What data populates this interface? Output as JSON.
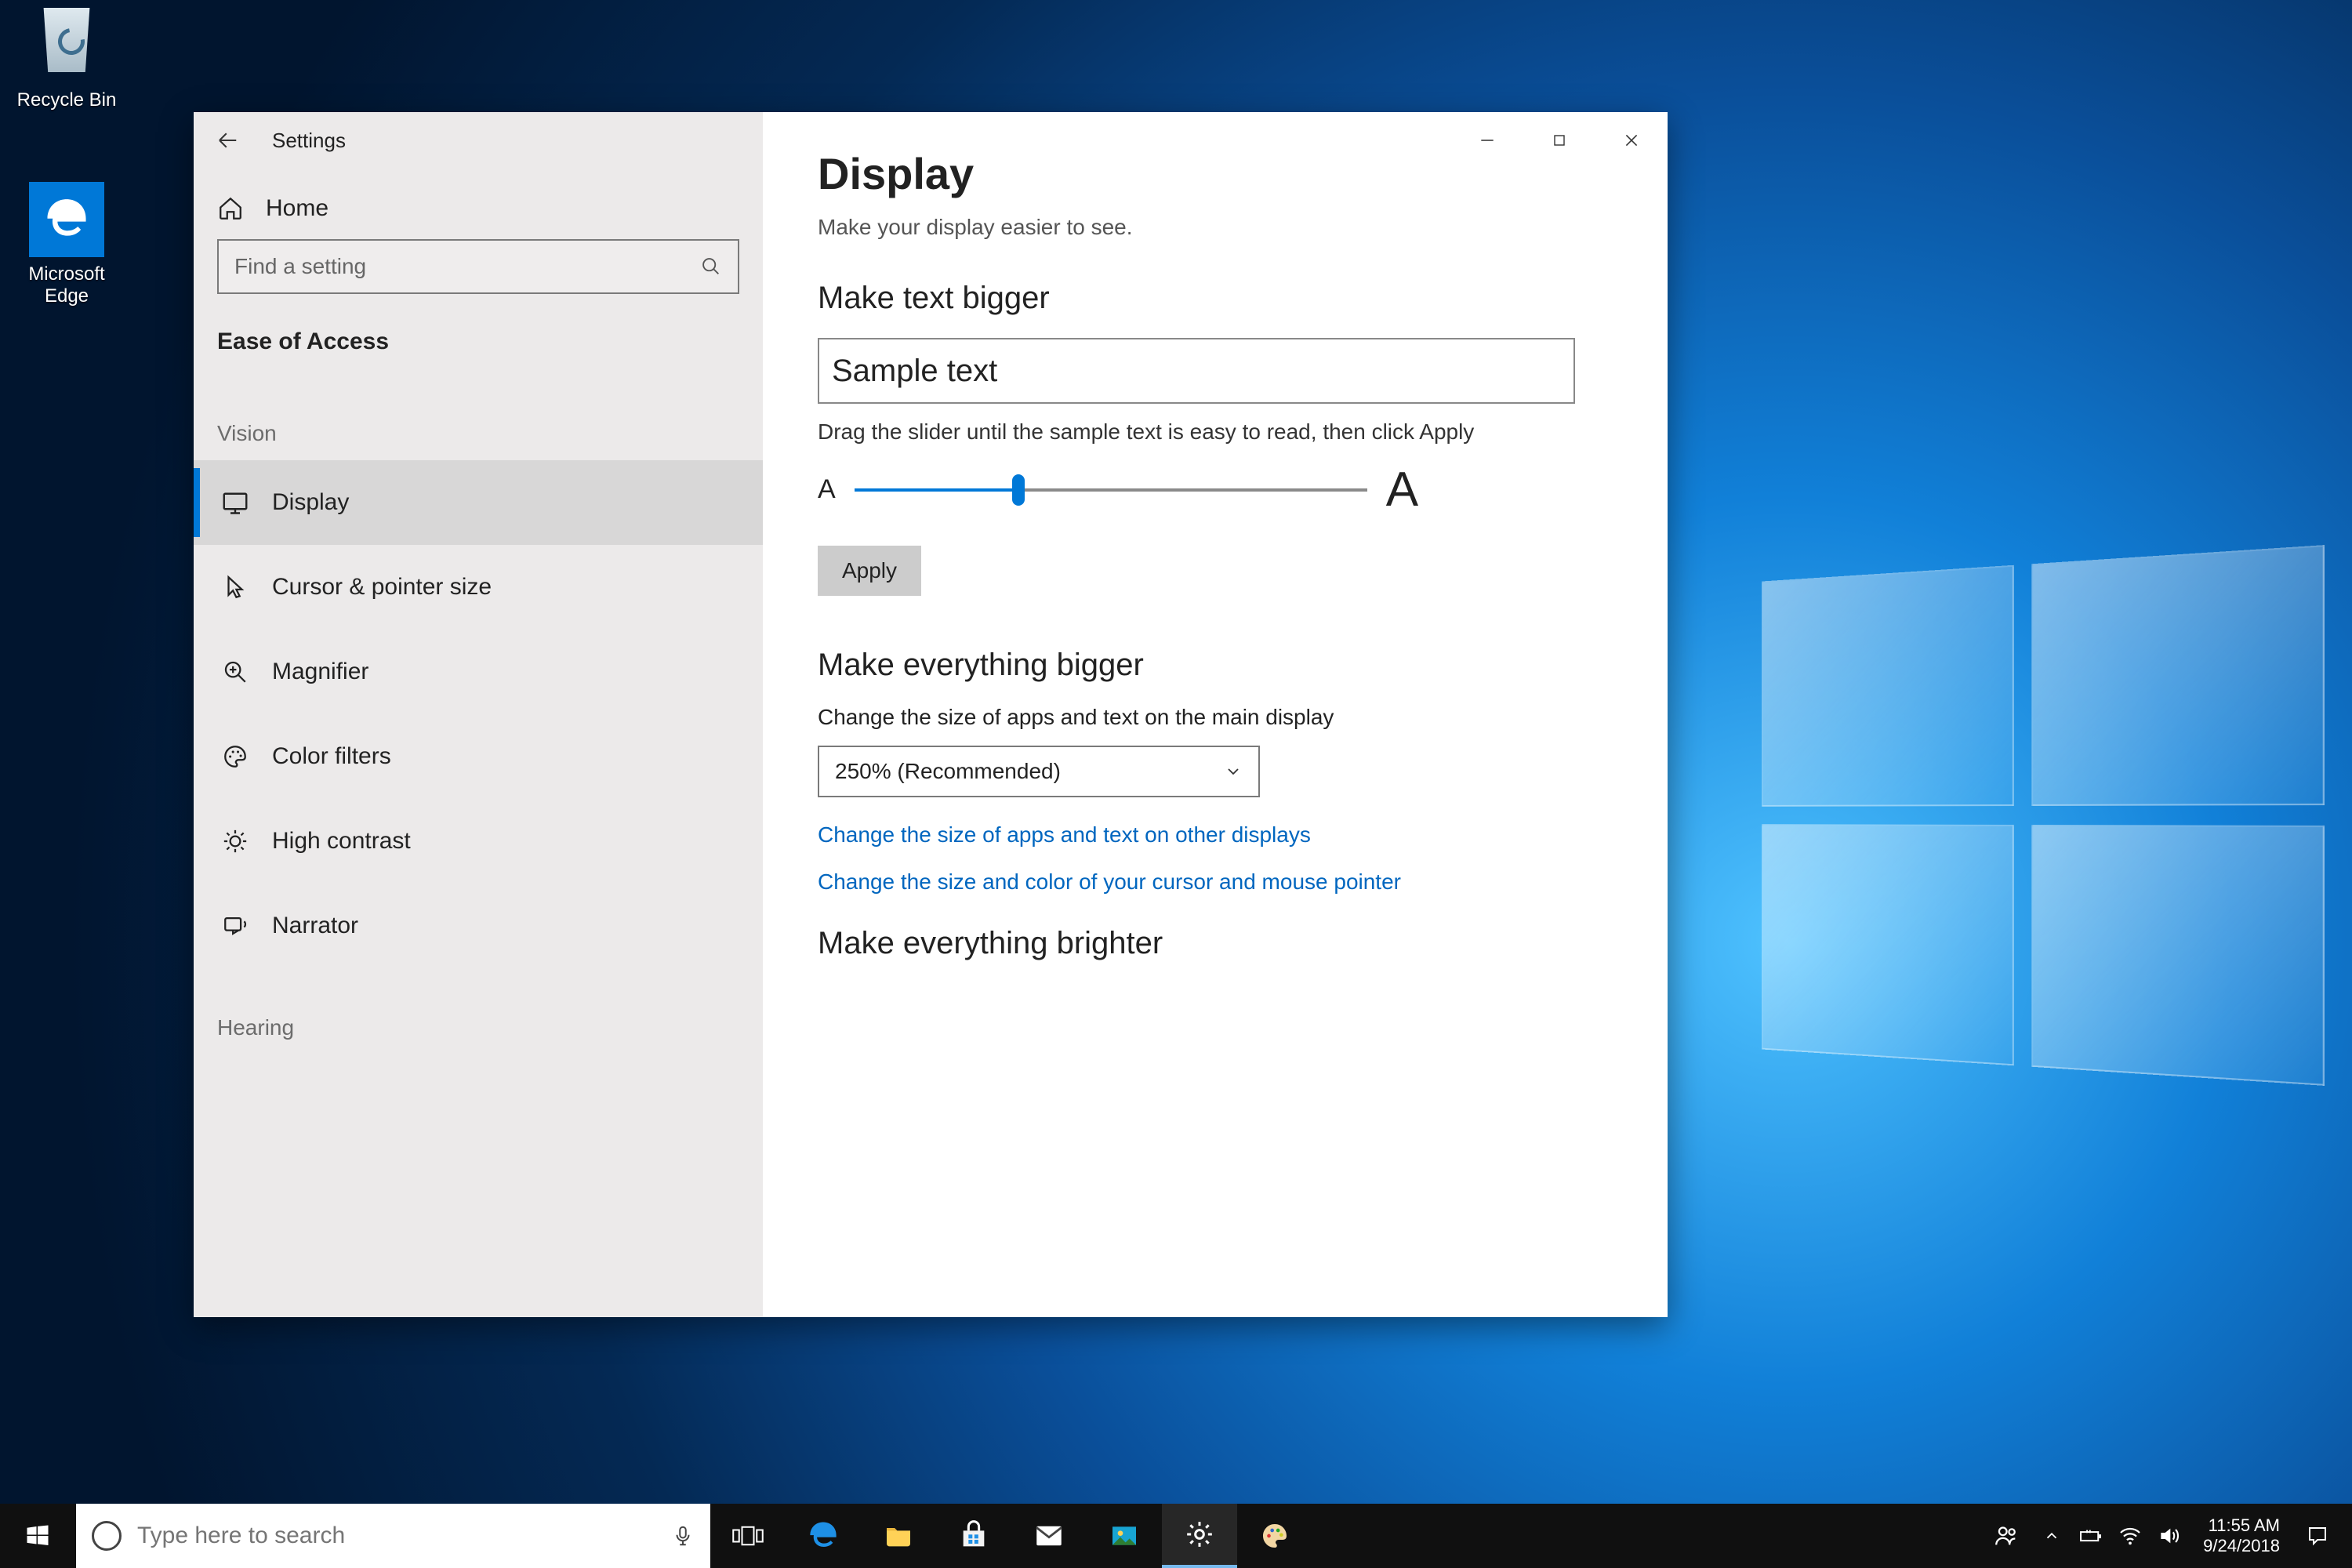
{
  "desktop": {
    "recycle_label": "Recycle Bin",
    "edge_label": "Microsoft Edge"
  },
  "window": {
    "title": "Settings",
    "home": "Home",
    "search_placeholder": "Find a setting",
    "category": "Ease of Access",
    "group_vision": "Vision",
    "group_hearing": "Hearing",
    "nav": {
      "display": "Display",
      "cursor": "Cursor & pointer size",
      "magnifier": "Magnifier",
      "colorfilters": "Color filters",
      "highcontrast": "High contrast",
      "narrator": "Narrator"
    }
  },
  "page": {
    "title": "Display",
    "subtitle": "Make your display easier to see.",
    "sec_text": "Make text bigger",
    "sample": "Sample text",
    "slider_hint": "Drag the slider until the sample text is easy to read, then click Apply",
    "small_a": "A",
    "big_a": "A",
    "apply": "Apply",
    "sec_bigger": "Make everything bigger",
    "bigger_desc": "Change the size of apps and text on the main display",
    "scale_value": "250% (Recommended)",
    "link_other": "Change the size of apps and text on other displays",
    "link_cursor": "Change the size and color of your cursor and mouse pointer",
    "sec_brighter": "Make everything brighter"
  },
  "taskbar": {
    "search_placeholder": "Type here to search",
    "time": "11:55 AM",
    "date": "9/24/2018"
  }
}
